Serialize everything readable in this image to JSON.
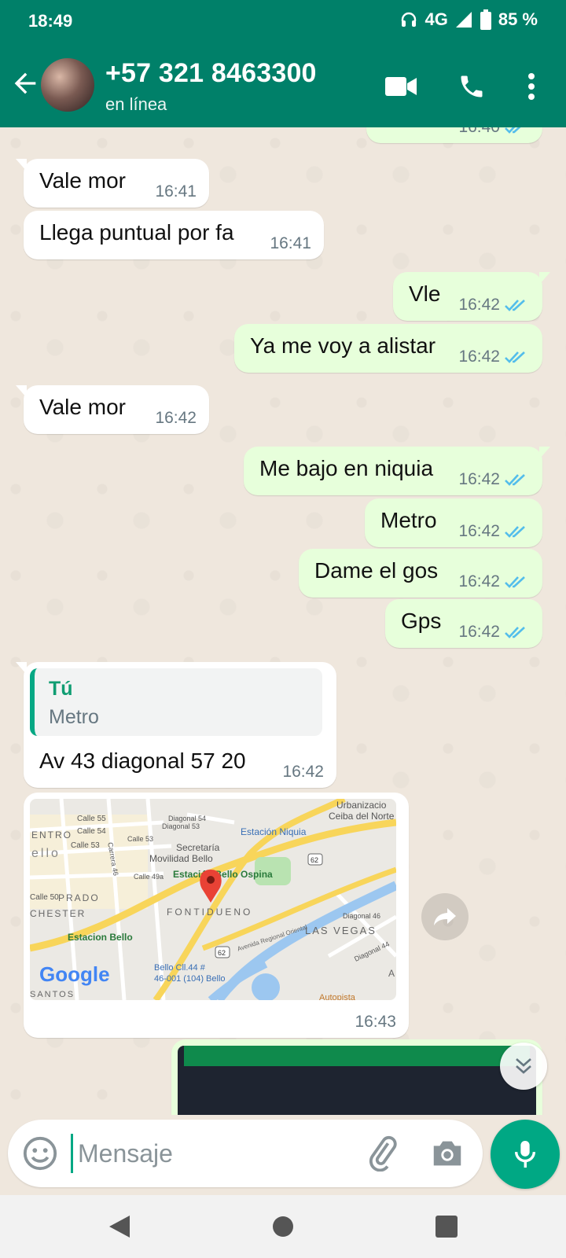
{
  "status_bar": {
    "time": "18:49",
    "network": "4G",
    "battery": "85 %"
  },
  "header": {
    "contact_name": "+57 321 8463300",
    "contact_status": "en línea"
  },
  "messages": [
    {
      "dir": "in",
      "text": "Vale mor",
      "time": "16:41"
    },
    {
      "dir": "in",
      "text": "Llega puntual por fa",
      "time": "16:41"
    },
    {
      "dir": "out",
      "text": "Vle",
      "time": "16:42"
    },
    {
      "dir": "out",
      "text": "Ya me voy a alistar",
      "time": "16:42"
    },
    {
      "dir": "in",
      "text": "Vale mor",
      "time": "16:42"
    },
    {
      "dir": "out",
      "text": "Me bajo en niquia",
      "time": "16:42"
    },
    {
      "dir": "out",
      "text": "Metro",
      "time": "16:42"
    },
    {
      "dir": "out",
      "text": "Dame el gos",
      "time": "16:42"
    },
    {
      "dir": "out",
      "text": "Gps",
      "time": "16:42"
    }
  ],
  "top_partial_time": "16:40",
  "reply_message": {
    "quote_author": "Tú",
    "quote_text": "Metro",
    "text": "Av 43 diagonal 57 20",
    "time": "16:42"
  },
  "location_message": {
    "time": "16:43",
    "map_labels": {
      "urbanizacion": "Urbanizacio",
      "ceiba": "Ceiba del Norte",
      "calle55": "Calle 55",
      "calle54": "Calle 54",
      "calle53a": "Calle 53",
      "calle53b": "Calle 53",
      "diag54": "Diagonal 54",
      "diag53": "Diagonal 53",
      "entro": "ENTRO",
      "ello": "ello",
      "carrera46": "Carrera 46",
      "estacion_niquia": "Estación Niquia",
      "secretaria": "Secretaría",
      "movilidad": "Movilidad Bello",
      "calle49a": "Calle 49a",
      "estacion_ospina": "Estación Bello Ospina",
      "calle50": "Calle 50",
      "prado": "PRADO",
      "chester": "CHESTER",
      "fontidueno": "FONTIDUENO",
      "estacion_bello": "Estacion Bello",
      "las_vegas": "LAS VEGAS",
      "diag46": "Diagonal 46",
      "diag44": "Diagonal 44",
      "avenida": "Avenida Regional Oriental",
      "r62a": "62",
      "r62b": "62",
      "bello_cll": "Bello Cll.44 #",
      "bello_cll2": "46-001 (104) Bello",
      "santos": "SANTOS",
      "autopista": "Autopista",
      "a": "A",
      "google": "Google"
    }
  },
  "input": {
    "placeholder": "Mensaje"
  },
  "colors": {
    "header": "#008069",
    "accent": "#00a884",
    "tick": "#53bdeb",
    "out_bubble": "#e7ffdb"
  }
}
